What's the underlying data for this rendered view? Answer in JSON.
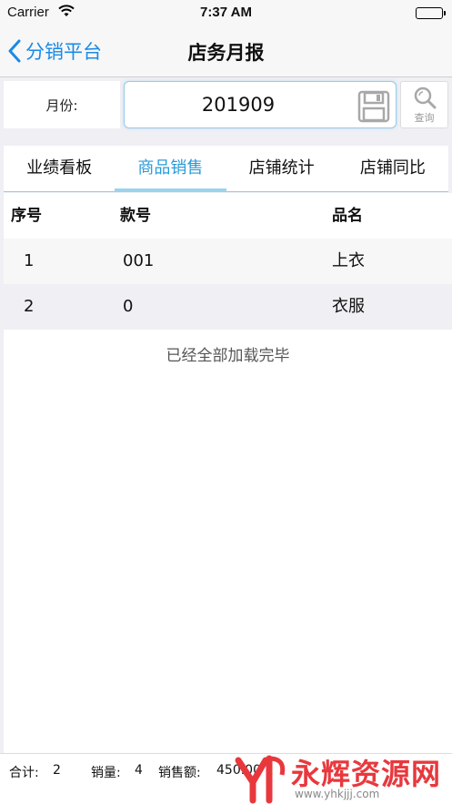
{
  "status": {
    "carrier": "Carrier",
    "time": "7:37 AM",
    "battery_level": 1.0
  },
  "nav": {
    "back_label": "分销平台",
    "title": "店务月报"
  },
  "month": {
    "label": "月份:",
    "value": "201909",
    "search_label": "查询"
  },
  "tabs": [
    {
      "label": "业绩看板",
      "active": false
    },
    {
      "label": "商品销售",
      "active": true
    },
    {
      "label": "店铺统计",
      "active": false
    },
    {
      "label": "店铺同比",
      "active": false
    }
  ],
  "table": {
    "headers": [
      "序号",
      "款号",
      "品名"
    ],
    "rows": [
      [
        "1",
        "001",
        "上衣"
      ],
      [
        "2",
        "0",
        "衣服"
      ]
    ],
    "load_complete": "已经全部加载完毕"
  },
  "footer": {
    "total_label": "合计:",
    "total_value": "2",
    "qty_label": "销量:",
    "qty_value": "4",
    "amount_label": "销售额:",
    "amount_value": "450.00"
  },
  "watermark": {
    "text": "永辉资源网",
    "url": "www.yhkjjj.com"
  },
  "colors": {
    "accent": "#1a8ae6",
    "tab_active": "#2a9ad8",
    "watermark": "#e8383d"
  }
}
